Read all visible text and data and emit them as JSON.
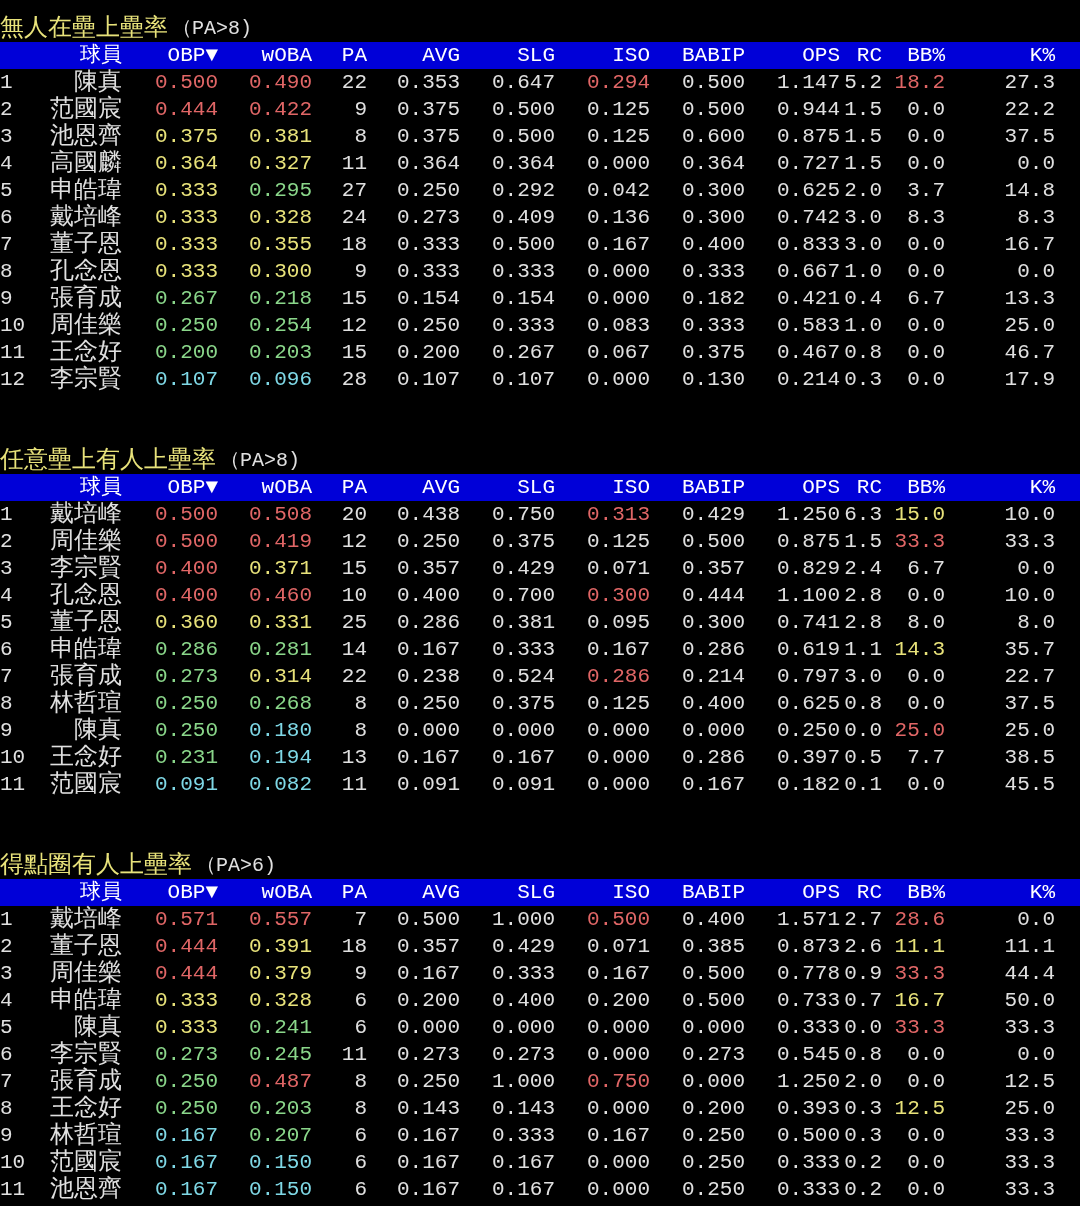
{
  "sections": [
    {
      "title": "無人在壘上壘率",
      "condition": "（PA>8)",
      "columns": [
        "球員",
        "OBP▼",
        "wOBA",
        "PA",
        "AVG",
        "SLG",
        "ISO",
        "BABIP",
        "OPS",
        "RC",
        "BB%",
        "K%"
      ],
      "rows": [
        {
          "rank": "1",
          "player": "陳真",
          "stats": [
            {
              "text": "0.500",
              "color": "#e06666"
            },
            {
              "text": "0.490",
              "color": "#e06666"
            },
            {
              "text": "22"
            },
            {
              "text": "0.353"
            },
            {
              "text": "0.647"
            },
            {
              "text": "0.294",
              "color": "#e06666"
            },
            {
              "text": "0.500"
            },
            {
              "text": "1.147"
            },
            {
              "text": "5.2"
            },
            {
              "text": "18.2",
              "color": "#e06666"
            },
            {
              "text": "27.3"
            }
          ]
        },
        {
          "rank": "2",
          "player": "范國宸",
          "stats": [
            {
              "text": "0.444",
              "color": "#e06666"
            },
            {
              "text": "0.422",
              "color": "#e06666"
            },
            {
              "text": "9"
            },
            {
              "text": "0.375"
            },
            {
              "text": "0.500"
            },
            {
              "text": "0.125"
            },
            {
              "text": "0.500"
            },
            {
              "text": "0.944"
            },
            {
              "text": "1.5"
            },
            {
              "text": "0.0"
            },
            {
              "text": "22.2"
            }
          ]
        },
        {
          "rank": "3",
          "player": "池恩齊",
          "stats": [
            {
              "text": "0.375",
              "color": "#e8e27a"
            },
            {
              "text": "0.381",
              "color": "#e8e27a"
            },
            {
              "text": "8"
            },
            {
              "text": "0.375"
            },
            {
              "text": "0.500"
            },
            {
              "text": "0.125"
            },
            {
              "text": "0.600"
            },
            {
              "text": "0.875"
            },
            {
              "text": "1.5"
            },
            {
              "text": "0.0"
            },
            {
              "text": "37.5"
            }
          ]
        },
        {
          "rank": "4",
          "player": "高國麟",
          "stats": [
            {
              "text": "0.364",
              "color": "#e8e27a"
            },
            {
              "text": "0.327",
              "color": "#e8e27a"
            },
            {
              "text": "11"
            },
            {
              "text": "0.364"
            },
            {
              "text": "0.364"
            },
            {
              "text": "0.000"
            },
            {
              "text": "0.364"
            },
            {
              "text": "0.727"
            },
            {
              "text": "1.5"
            },
            {
              "text": "0.0"
            },
            {
              "text": "0.0"
            }
          ]
        },
        {
          "rank": "5",
          "player": "申皓瑋",
          "stats": [
            {
              "text": "0.333",
              "color": "#e8e27a"
            },
            {
              "text": "0.295",
              "color": "#8ad68a"
            },
            {
              "text": "27"
            },
            {
              "text": "0.250"
            },
            {
              "text": "0.292"
            },
            {
              "text": "0.042"
            },
            {
              "text": "0.300"
            },
            {
              "text": "0.625"
            },
            {
              "text": "2.0"
            },
            {
              "text": "3.7"
            },
            {
              "text": "14.8"
            }
          ]
        },
        {
          "rank": "6",
          "player": "戴培峰",
          "stats": [
            {
              "text": "0.333",
              "color": "#e8e27a"
            },
            {
              "text": "0.328",
              "color": "#e8e27a"
            },
            {
              "text": "24"
            },
            {
              "text": "0.273"
            },
            {
              "text": "0.409"
            },
            {
              "text": "0.136"
            },
            {
              "text": "0.300"
            },
            {
              "text": "0.742"
            },
            {
              "text": "3.0"
            },
            {
              "text": "8.3"
            },
            {
              "text": "8.3"
            }
          ]
        },
        {
          "rank": "7",
          "player": "董子恩",
          "stats": [
            {
              "text": "0.333",
              "color": "#e8e27a"
            },
            {
              "text": "0.355",
              "color": "#e8e27a"
            },
            {
              "text": "18"
            },
            {
              "text": "0.333"
            },
            {
              "text": "0.500"
            },
            {
              "text": "0.167"
            },
            {
              "text": "0.400"
            },
            {
              "text": "0.833"
            },
            {
              "text": "3.0"
            },
            {
              "text": "0.0"
            },
            {
              "text": "16.7"
            }
          ]
        },
        {
          "rank": "8",
          "player": "孔念恩",
          "stats": [
            {
              "text": "0.333",
              "color": "#e8e27a"
            },
            {
              "text": "0.300",
              "color": "#e8e27a"
            },
            {
              "text": "9"
            },
            {
              "text": "0.333"
            },
            {
              "text": "0.333"
            },
            {
              "text": "0.000"
            },
            {
              "text": "0.333"
            },
            {
              "text": "0.667"
            },
            {
              "text": "1.0"
            },
            {
              "text": "0.0"
            },
            {
              "text": "0.0"
            }
          ]
        },
        {
          "rank": "9",
          "player": "張育成",
          "stats": [
            {
              "text": "0.267",
              "color": "#8ad68a"
            },
            {
              "text": "0.218",
              "color": "#8ad68a"
            },
            {
              "text": "15"
            },
            {
              "text": "0.154"
            },
            {
              "text": "0.154"
            },
            {
              "text": "0.000"
            },
            {
              "text": "0.182"
            },
            {
              "text": "0.421"
            },
            {
              "text": "0.4"
            },
            {
              "text": "6.7"
            },
            {
              "text": "13.3"
            }
          ]
        },
        {
          "rank": "10",
          "player": "周佳樂",
          "stats": [
            {
              "text": "0.250",
              "color": "#8ad68a"
            },
            {
              "text": "0.254",
              "color": "#8ad68a"
            },
            {
              "text": "12"
            },
            {
              "text": "0.250"
            },
            {
              "text": "0.333"
            },
            {
              "text": "0.083"
            },
            {
              "text": "0.333"
            },
            {
              "text": "0.583"
            },
            {
              "text": "1.0"
            },
            {
              "text": "0.0"
            },
            {
              "text": "25.0"
            }
          ]
        },
        {
          "rank": "11",
          "player": "王念好",
          "stats": [
            {
              "text": "0.200",
              "color": "#8ad68a"
            },
            {
              "text": "0.203",
              "color": "#8ad68a"
            },
            {
              "text": "15"
            },
            {
              "text": "0.200"
            },
            {
              "text": "0.267"
            },
            {
              "text": "0.067"
            },
            {
              "text": "0.375"
            },
            {
              "text": "0.467"
            },
            {
              "text": "0.8"
            },
            {
              "text": "0.0"
            },
            {
              "text": "46.7"
            }
          ]
        },
        {
          "rank": "12",
          "player": "李宗賢",
          "stats": [
            {
              "text": "0.107",
              "color": "#7fd8e6"
            },
            {
              "text": "0.096",
              "color": "#7fd8e6"
            },
            {
              "text": "28"
            },
            {
              "text": "0.107"
            },
            {
              "text": "0.107"
            },
            {
              "text": "0.000"
            },
            {
              "text": "0.130"
            },
            {
              "text": "0.214"
            },
            {
              "text": "0.3"
            },
            {
              "text": "0.0"
            },
            {
              "text": "17.9"
            }
          ]
        }
      ]
    },
    {
      "title": "任意壘上有人上壘率",
      "condition": "（PA>8)",
      "columns": [
        "球員",
        "OBP▼",
        "wOBA",
        "PA",
        "AVG",
        "SLG",
        "ISO",
        "BABIP",
        "OPS",
        "RC",
        "BB%",
        "K%"
      ],
      "rows": [
        {
          "rank": "1",
          "player": "戴培峰",
          "stats": [
            {
              "text": "0.500",
              "color": "#e06666"
            },
            {
              "text": "0.508",
              "color": "#e06666"
            },
            {
              "text": "20"
            },
            {
              "text": "0.438"
            },
            {
              "text": "0.750"
            },
            {
              "text": "0.313",
              "color": "#e06666"
            },
            {
              "text": "0.429"
            },
            {
              "text": "1.250"
            },
            {
              "text": "6.3"
            },
            {
              "text": "15.0",
              "color": "#e8e27a"
            },
            {
              "text": "10.0"
            }
          ]
        },
        {
          "rank": "2",
          "player": "周佳樂",
          "stats": [
            {
              "text": "0.500",
              "color": "#e06666"
            },
            {
              "text": "0.419",
              "color": "#e06666"
            },
            {
              "text": "12"
            },
            {
              "text": "0.250"
            },
            {
              "text": "0.375"
            },
            {
              "text": "0.125"
            },
            {
              "text": "0.500"
            },
            {
              "text": "0.875"
            },
            {
              "text": "1.5"
            },
            {
              "text": "33.3",
              "color": "#e06666"
            },
            {
              "text": "33.3"
            }
          ]
        },
        {
          "rank": "3",
          "player": "李宗賢",
          "stats": [
            {
              "text": "0.400",
              "color": "#e06666"
            },
            {
              "text": "0.371",
              "color": "#e8e27a"
            },
            {
              "text": "15"
            },
            {
              "text": "0.357"
            },
            {
              "text": "0.429"
            },
            {
              "text": "0.071"
            },
            {
              "text": "0.357"
            },
            {
              "text": "0.829"
            },
            {
              "text": "2.4"
            },
            {
              "text": "6.7"
            },
            {
              "text": "0.0"
            }
          ]
        },
        {
          "rank": "4",
          "player": "孔念恩",
          "stats": [
            {
              "text": "0.400",
              "color": "#e06666"
            },
            {
              "text": "0.460",
              "color": "#e06666"
            },
            {
              "text": "10"
            },
            {
              "text": "0.400"
            },
            {
              "text": "0.700"
            },
            {
              "text": "0.300",
              "color": "#e06666"
            },
            {
              "text": "0.444"
            },
            {
              "text": "1.100"
            },
            {
              "text": "2.8"
            },
            {
              "text": "0.0"
            },
            {
              "text": "10.0"
            }
          ]
        },
        {
          "rank": "5",
          "player": "董子恩",
          "stats": [
            {
              "text": "0.360",
              "color": "#e8e27a"
            },
            {
              "text": "0.331",
              "color": "#e8e27a"
            },
            {
              "text": "25"
            },
            {
              "text": "0.286"
            },
            {
              "text": "0.381"
            },
            {
              "text": "0.095"
            },
            {
              "text": "0.300"
            },
            {
              "text": "0.741"
            },
            {
              "text": "2.8"
            },
            {
              "text": "8.0"
            },
            {
              "text": "8.0"
            }
          ]
        },
        {
          "rank": "6",
          "player": "申皓瑋",
          "stats": [
            {
              "text": "0.286",
              "color": "#8ad68a"
            },
            {
              "text": "0.281",
              "color": "#8ad68a"
            },
            {
              "text": "14"
            },
            {
              "text": "0.167"
            },
            {
              "text": "0.333"
            },
            {
              "text": "0.167"
            },
            {
              "text": "0.286"
            },
            {
              "text": "0.619"
            },
            {
              "text": "1.1"
            },
            {
              "text": "14.3",
              "color": "#e8e27a"
            },
            {
              "text": "35.7"
            }
          ]
        },
        {
          "rank": "7",
          "player": "張育成",
          "stats": [
            {
              "text": "0.273",
              "color": "#8ad68a"
            },
            {
              "text": "0.314",
              "color": "#e8e27a"
            },
            {
              "text": "22"
            },
            {
              "text": "0.238"
            },
            {
              "text": "0.524"
            },
            {
              "text": "0.286",
              "color": "#e06666"
            },
            {
              "text": "0.214"
            },
            {
              "text": "0.797"
            },
            {
              "text": "3.0"
            },
            {
              "text": "0.0"
            },
            {
              "text": "22.7"
            }
          ]
        },
        {
          "rank": "8",
          "player": "林哲瑄",
          "stats": [
            {
              "text": "0.250",
              "color": "#8ad68a"
            },
            {
              "text": "0.268",
              "color": "#8ad68a"
            },
            {
              "text": "8"
            },
            {
              "text": "0.250"
            },
            {
              "text": "0.375"
            },
            {
              "text": "0.125"
            },
            {
              "text": "0.400"
            },
            {
              "text": "0.625"
            },
            {
              "text": "0.8"
            },
            {
              "text": "0.0"
            },
            {
              "text": "37.5"
            }
          ]
        },
        {
          "rank": "9",
          "player": "陳真",
          "stats": [
            {
              "text": "0.250",
              "color": "#8ad68a"
            },
            {
              "text": "0.180",
              "color": "#7fd8e6"
            },
            {
              "text": "8"
            },
            {
              "text": "0.000"
            },
            {
              "text": "0.000"
            },
            {
              "text": "0.000"
            },
            {
              "text": "0.000"
            },
            {
              "text": "0.250"
            },
            {
              "text": "0.0"
            },
            {
              "text": "25.0",
              "color": "#e06666"
            },
            {
              "text": "25.0"
            }
          ]
        },
        {
          "rank": "10",
          "player": "王念好",
          "stats": [
            {
              "text": "0.231",
              "color": "#8ad68a"
            },
            {
              "text": "0.194",
              "color": "#7fd8e6"
            },
            {
              "text": "13"
            },
            {
              "text": "0.167"
            },
            {
              "text": "0.167"
            },
            {
              "text": "0.000"
            },
            {
              "text": "0.286"
            },
            {
              "text": "0.397"
            },
            {
              "text": "0.5"
            },
            {
              "text": "7.7"
            },
            {
              "text": "38.5"
            }
          ]
        },
        {
          "rank": "11",
          "player": "范國宸",
          "stats": [
            {
              "text": "0.091",
              "color": "#7fd8e6"
            },
            {
              "text": "0.082",
              "color": "#7fd8e6"
            },
            {
              "text": "11"
            },
            {
              "text": "0.091"
            },
            {
              "text": "0.091"
            },
            {
              "text": "0.000"
            },
            {
              "text": "0.167"
            },
            {
              "text": "0.182"
            },
            {
              "text": "0.1"
            },
            {
              "text": "0.0"
            },
            {
              "text": "45.5"
            }
          ]
        }
      ]
    },
    {
      "title": "得點圈有人上壘率",
      "condition": "（PA>6)",
      "columns": [
        "球員",
        "OBP▼",
        "wOBA",
        "PA",
        "AVG",
        "SLG",
        "ISO",
        "BABIP",
        "OPS",
        "RC",
        "BB%",
        "K%"
      ],
      "rows": [
        {
          "rank": "1",
          "player": "戴培峰",
          "stats": [
            {
              "text": "0.571",
              "color": "#e06666"
            },
            {
              "text": "0.557",
              "color": "#e06666"
            },
            {
              "text": "7"
            },
            {
              "text": "0.500"
            },
            {
              "text": "1.000"
            },
            {
              "text": "0.500",
              "color": "#e06666"
            },
            {
              "text": "0.400"
            },
            {
              "text": "1.571"
            },
            {
              "text": "2.7"
            },
            {
              "text": "28.6",
              "color": "#e06666"
            },
            {
              "text": "0.0"
            }
          ]
        },
        {
          "rank": "2",
          "player": "董子恩",
          "stats": [
            {
              "text": "0.444",
              "color": "#e06666"
            },
            {
              "text": "0.391",
              "color": "#e8e27a"
            },
            {
              "text": "18"
            },
            {
              "text": "0.357"
            },
            {
              "text": "0.429"
            },
            {
              "text": "0.071"
            },
            {
              "text": "0.385"
            },
            {
              "text": "0.873"
            },
            {
              "text": "2.6"
            },
            {
              "text": "11.1",
              "color": "#e8e27a"
            },
            {
              "text": "11.1"
            }
          ]
        },
        {
          "rank": "3",
          "player": "周佳樂",
          "stats": [
            {
              "text": "0.444",
              "color": "#e06666"
            },
            {
              "text": "0.379",
              "color": "#e8e27a"
            },
            {
              "text": "9"
            },
            {
              "text": "0.167"
            },
            {
              "text": "0.333"
            },
            {
              "text": "0.167"
            },
            {
              "text": "0.500"
            },
            {
              "text": "0.778"
            },
            {
              "text": "0.9"
            },
            {
              "text": "33.3",
              "color": "#e06666"
            },
            {
              "text": "44.4"
            }
          ]
        },
        {
          "rank": "4",
          "player": "申皓瑋",
          "stats": [
            {
              "text": "0.333",
              "color": "#e8e27a"
            },
            {
              "text": "0.328",
              "color": "#e8e27a"
            },
            {
              "text": "6"
            },
            {
              "text": "0.200"
            },
            {
              "text": "0.400"
            },
            {
              "text": "0.200"
            },
            {
              "text": "0.500"
            },
            {
              "text": "0.733"
            },
            {
              "text": "0.7"
            },
            {
              "text": "16.7",
              "color": "#e8e27a"
            },
            {
              "text": "50.0"
            }
          ]
        },
        {
          "rank": "5",
          "player": "陳真",
          "stats": [
            {
              "text": "0.333",
              "color": "#e8e27a"
            },
            {
              "text": "0.241",
              "color": "#8ad68a"
            },
            {
              "text": "6"
            },
            {
              "text": "0.000"
            },
            {
              "text": "0.000"
            },
            {
              "text": "0.000"
            },
            {
              "text": "0.000"
            },
            {
              "text": "0.333"
            },
            {
              "text": "0.0"
            },
            {
              "text": "33.3",
              "color": "#e06666"
            },
            {
              "text": "33.3"
            }
          ]
        },
        {
          "rank": "6",
          "player": "李宗賢",
          "stats": [
            {
              "text": "0.273",
              "color": "#8ad68a"
            },
            {
              "text": "0.245",
              "color": "#8ad68a"
            },
            {
              "text": "11"
            },
            {
              "text": "0.273"
            },
            {
              "text": "0.273"
            },
            {
              "text": "0.000"
            },
            {
              "text": "0.273"
            },
            {
              "text": "0.545"
            },
            {
              "text": "0.8"
            },
            {
              "text": "0.0"
            },
            {
              "text": "0.0"
            }
          ]
        },
        {
          "rank": "7",
          "player": "張育成",
          "stats": [
            {
              "text": "0.250",
              "color": "#8ad68a"
            },
            {
              "text": "0.487",
              "color": "#e06666"
            },
            {
              "text": "8"
            },
            {
              "text": "0.250"
            },
            {
              "text": "1.000"
            },
            {
              "text": "0.750",
              "color": "#e06666"
            },
            {
              "text": "0.000"
            },
            {
              "text": "1.250"
            },
            {
              "text": "2.0"
            },
            {
              "text": "0.0"
            },
            {
              "text": "12.5"
            }
          ]
        },
        {
          "rank": "8",
          "player": "王念好",
          "stats": [
            {
              "text": "0.250",
              "color": "#8ad68a"
            },
            {
              "text": "0.203",
              "color": "#8ad68a"
            },
            {
              "text": "8"
            },
            {
              "text": "0.143"
            },
            {
              "text": "0.143"
            },
            {
              "text": "0.000"
            },
            {
              "text": "0.200"
            },
            {
              "text": "0.393"
            },
            {
              "text": "0.3"
            },
            {
              "text": "12.5",
              "color": "#e8e27a"
            },
            {
              "text": "25.0"
            }
          ]
        },
        {
          "rank": "9",
          "player": "林哲瑄",
          "stats": [
            {
              "text": "0.167",
              "color": "#7fd8e6"
            },
            {
              "text": "0.207",
              "color": "#8ad68a"
            },
            {
              "text": "6"
            },
            {
              "text": "0.167"
            },
            {
              "text": "0.333"
            },
            {
              "text": "0.167"
            },
            {
              "text": "0.250"
            },
            {
              "text": "0.500"
            },
            {
              "text": "0.3"
            },
            {
              "text": "0.0"
            },
            {
              "text": "33.3"
            }
          ]
        },
        {
          "rank": "10",
          "player": "范國宸",
          "stats": [
            {
              "text": "0.167",
              "color": "#7fd8e6"
            },
            {
              "text": "0.150",
              "color": "#7fd8e6"
            },
            {
              "text": "6"
            },
            {
              "text": "0.167"
            },
            {
              "text": "0.167"
            },
            {
              "text": "0.000"
            },
            {
              "text": "0.250"
            },
            {
              "text": "0.333"
            },
            {
              "text": "0.2"
            },
            {
              "text": "0.0"
            },
            {
              "text": "33.3"
            }
          ]
        },
        {
          "rank": "11",
          "player": "池恩齊",
          "stats": [
            {
              "text": "0.167",
              "color": "#7fd8e6"
            },
            {
              "text": "0.150",
              "color": "#7fd8e6"
            },
            {
              "text": "6"
            },
            {
              "text": "0.167"
            },
            {
              "text": "0.167"
            },
            {
              "text": "0.000"
            },
            {
              "text": "0.250"
            },
            {
              "text": "0.333"
            },
            {
              "text": "0.2"
            },
            {
              "text": "0.0"
            },
            {
              "text": "33.3"
            }
          ]
        }
      ]
    }
  ]
}
